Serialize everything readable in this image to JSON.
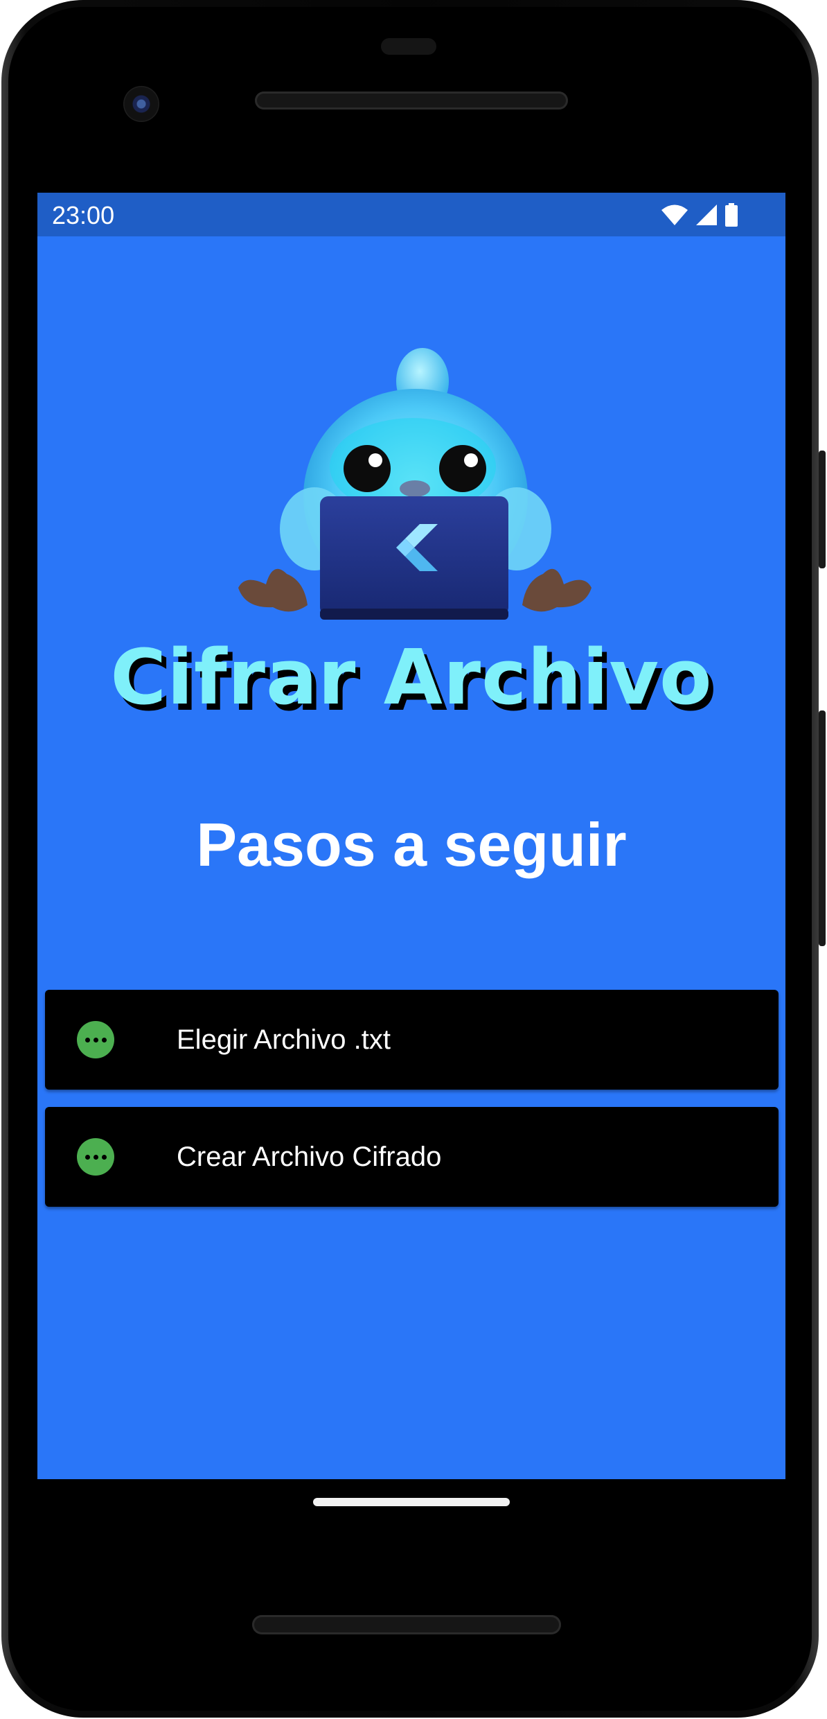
{
  "status_bar": {
    "time": "23:00",
    "icons": [
      "wifi-icon",
      "cell-signal-icon",
      "battery-icon"
    ]
  },
  "app": {
    "title": "Cifrar Archivo",
    "subtitle": "Pasos a seguir",
    "hero_image": "flutter-mascot-with-laptop"
  },
  "steps": [
    {
      "label": "Elegir Archivo .txt",
      "icon": "more-horiz-icon"
    },
    {
      "label": "Crear Archivo Cifrado",
      "icon": "more-horiz-icon"
    }
  ],
  "colors": {
    "background": "#2a76f8",
    "status_bar": "#1f5ec6",
    "title": "#7ff0fa",
    "step_card": "#000000",
    "step_icon": "#4caf50"
  }
}
